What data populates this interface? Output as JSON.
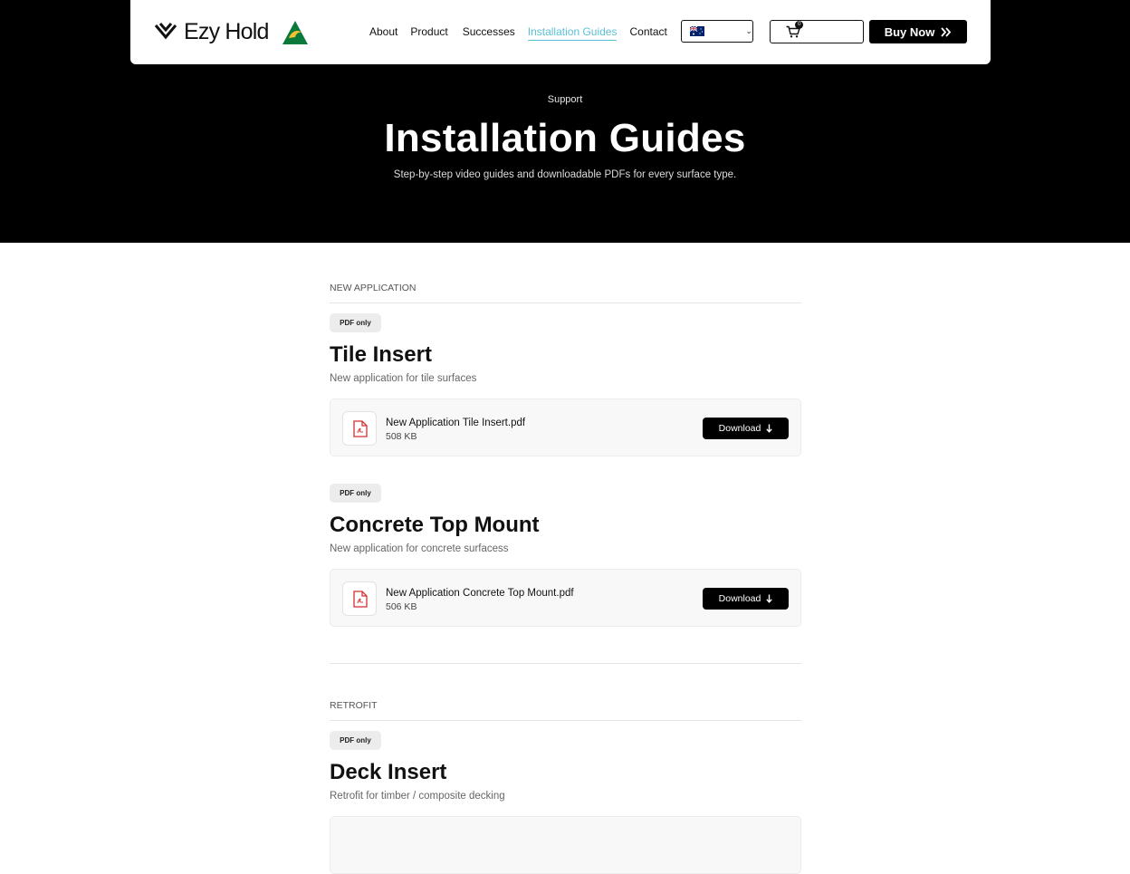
{
  "brand": {
    "name": "Ezy Hold"
  },
  "nav": {
    "items": [
      {
        "label": "About",
        "active": false
      },
      {
        "label": "Product",
        "active": false
      },
      {
        "label": "Successes",
        "active": false
      },
      {
        "label": "Installation Guides",
        "active": true
      },
      {
        "label": "Contact",
        "active": false
      }
    ]
  },
  "currency": {
    "label": "AUD $"
  },
  "cart": {
    "label": "My Cart",
    "count": "0"
  },
  "buy": {
    "label": "Buy Now"
  },
  "hero": {
    "eyebrow": "Support",
    "title": "Installation Guides",
    "subtitle": "Step-by-step video guides and downloadable PDFs for every surface type."
  },
  "sections": [
    {
      "label": "NEW APPLICATION",
      "guides": [
        {
          "badge": "PDF only",
          "title": "Tile Insert",
          "description": "New application for tile surfaces",
          "file": {
            "name": "New Application Tile Insert.pdf",
            "size": "508 KB",
            "button": "Download"
          }
        },
        {
          "badge": "PDF only",
          "title": "Concrete Top Mount",
          "description": "New application for concrete surfacess",
          "file": {
            "name": "New Application Concrete Top Mount.pdf",
            "size": "506 KB",
            "button": "Download"
          }
        }
      ]
    },
    {
      "label": "RETROFIT",
      "guides": [
        {
          "badge": "PDF only",
          "title": "Deck Insert",
          "description": "Retrofit for timber / composite decking"
        }
      ]
    }
  ],
  "colors": {
    "accent": "#5bbfd6",
    "hero_bg": "#000000",
    "pdf_red": "#d32f2f",
    "flag_green": "#0a7a3c",
    "badge_gold": "#f2c230"
  },
  "icons": [
    "logo-chevron-icon",
    "australian-made-icon",
    "au-flag-icon",
    "chevron-down-icon",
    "cart-icon",
    "double-chevron-right-icon",
    "pdf-file-icon",
    "download-arrow-icon"
  ]
}
